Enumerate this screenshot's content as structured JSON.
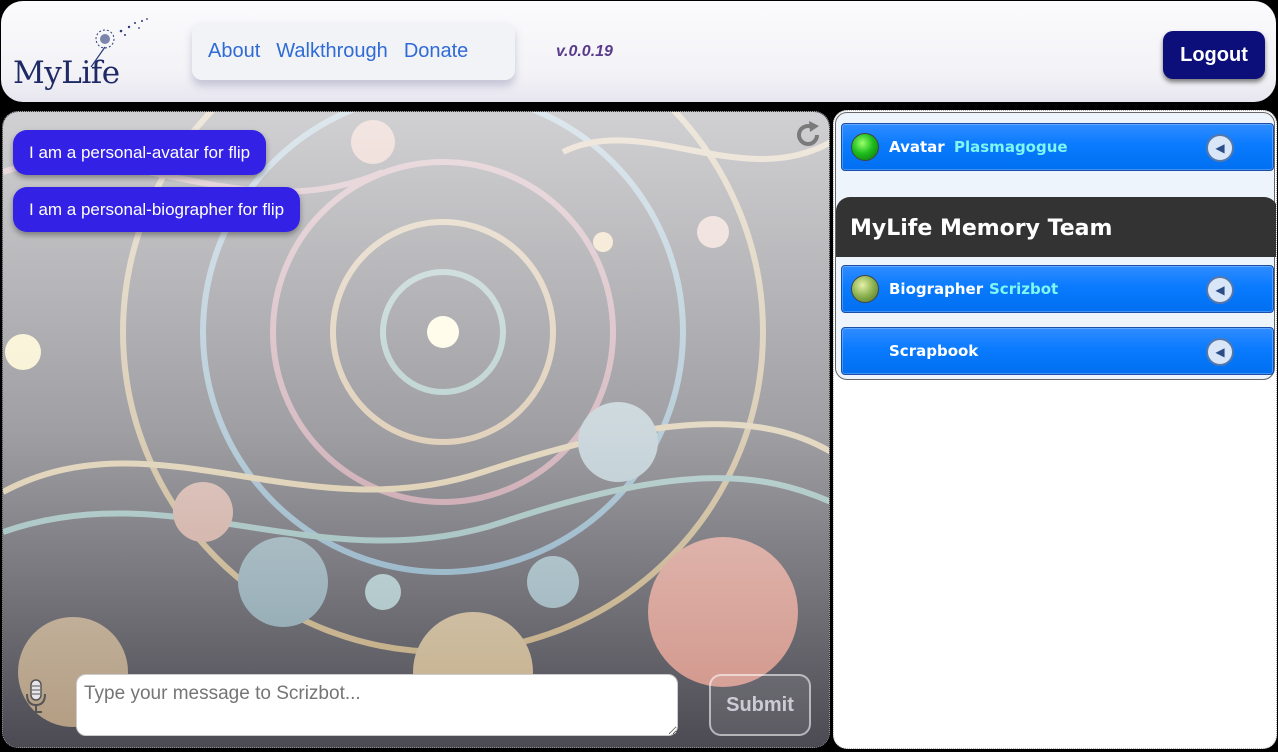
{
  "header": {
    "logo_text": "MyLife",
    "nav": [
      "About",
      "Walkthrough",
      "Donate"
    ],
    "version": "v.0.0.19",
    "logout_label": "Logout"
  },
  "chat": {
    "messages": [
      "I am a personal-avatar for flip",
      "I am a personal-biographer for flip"
    ],
    "input_placeholder": "Type your message to Scrizbot...",
    "submit_label": "Submit"
  },
  "sidebar": {
    "avatar": {
      "type": "Avatar",
      "name": "Plasmagogue"
    },
    "team_title": "MyLife Memory Team",
    "team": [
      {
        "type": "Biographer",
        "name": "Scrizbot"
      },
      {
        "type": "Scrapbook",
        "name": ""
      }
    ]
  },
  "colors": {
    "accent_blue": "#0a7bff",
    "bubble": "#3322e6",
    "logout": "#0c0f7a",
    "bot_name": "#7ff7ee"
  },
  "icons": [
    "dandelion-logo-icon",
    "refresh-icon",
    "microphone-icon",
    "collapse-arrow-icon",
    "status-dot-icon"
  ]
}
